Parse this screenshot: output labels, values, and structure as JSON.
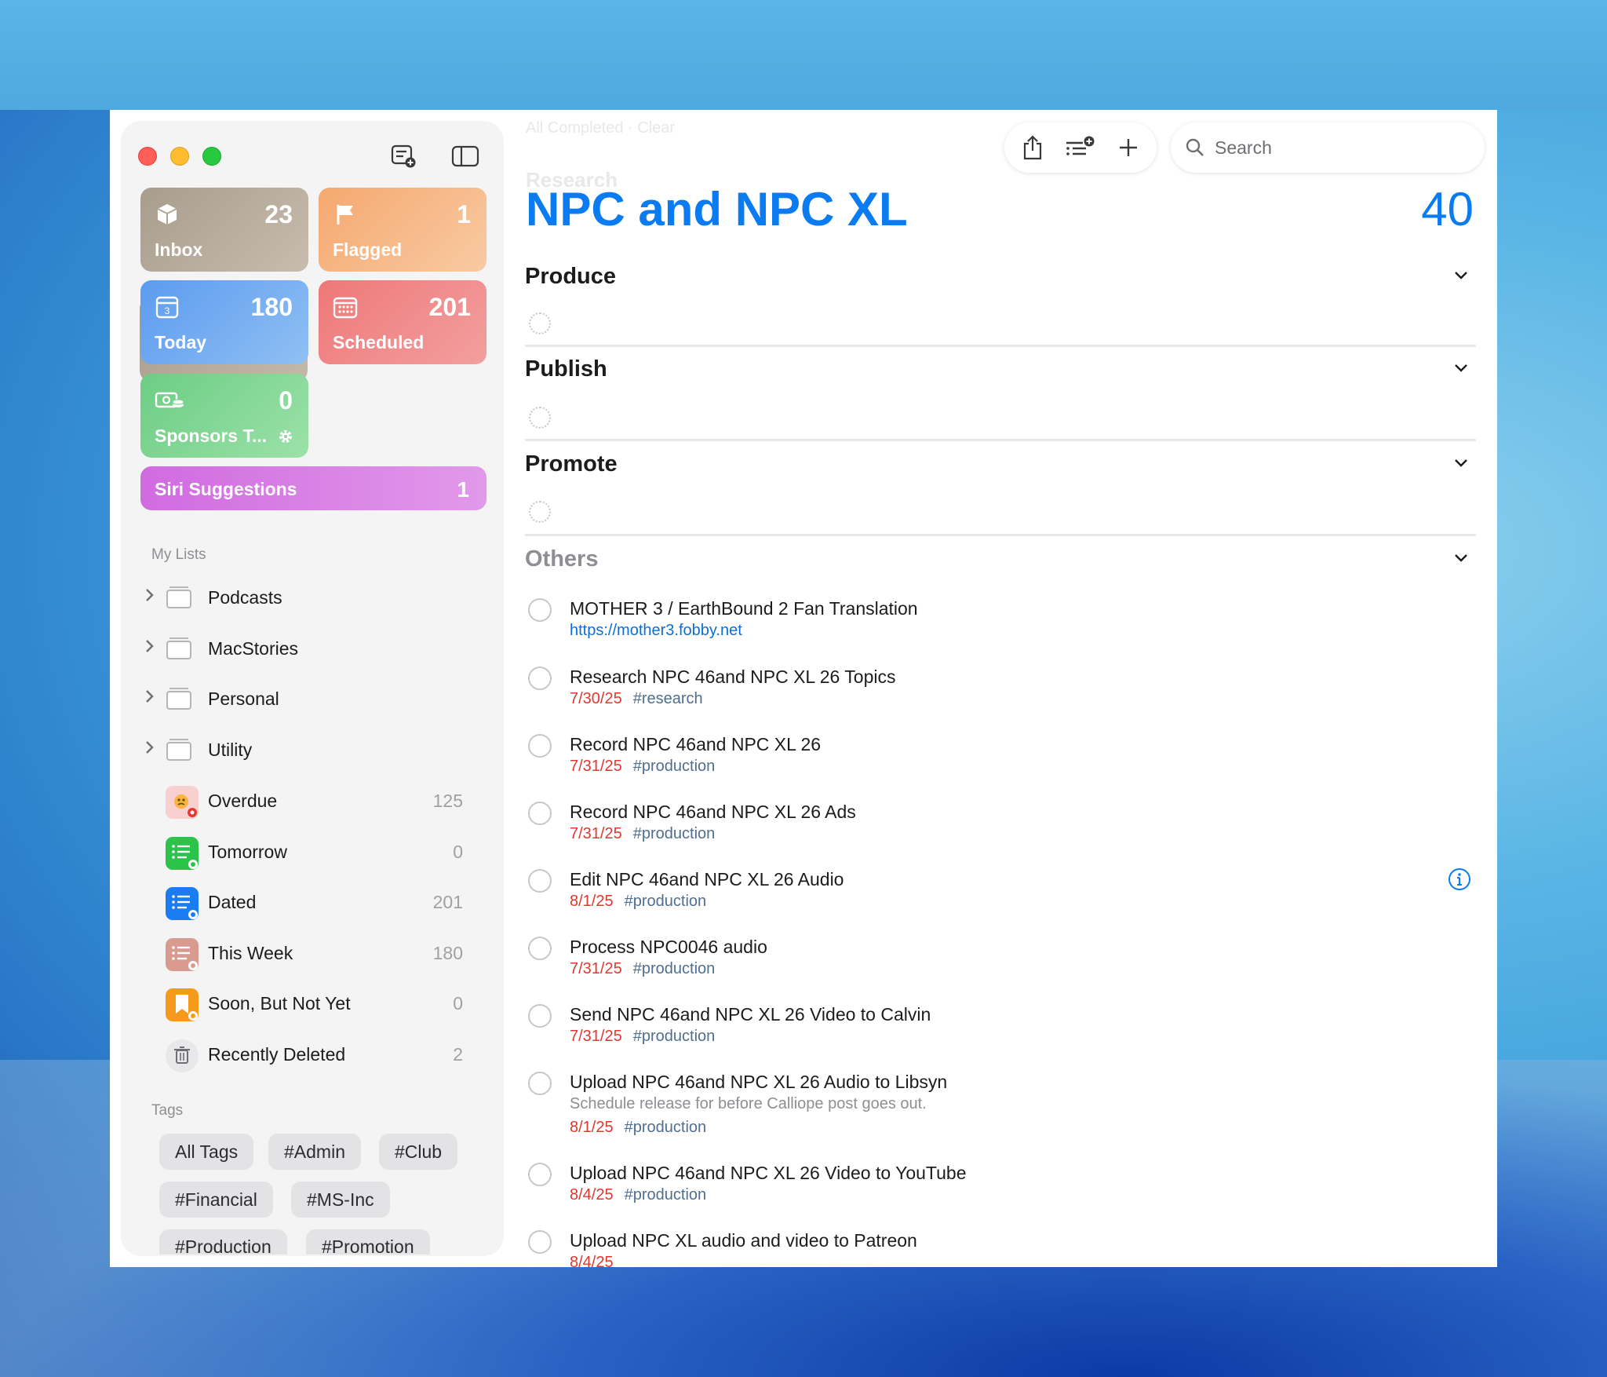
{
  "window": {
    "ghost_header": "All Completed · Clear",
    "ghost_section": "Research"
  },
  "toolbar": {
    "search_placeholder": "Search"
  },
  "sidebar": {
    "tiles": {
      "inbox": {
        "label": "Inbox",
        "count": "23"
      },
      "flagged": {
        "label": "Flagged",
        "count": "1"
      },
      "today": {
        "label": "Today",
        "count": "180",
        "icon_day": "3"
      },
      "scheduled": {
        "label": "Scheduled",
        "count": "201"
      },
      "sponsors": {
        "label": "Sponsors T...",
        "count": "0"
      }
    },
    "siri": {
      "label": "Siri Suggestions",
      "count": "1"
    },
    "my_lists_title": "My Lists",
    "groups": [
      {
        "label": "Podcasts"
      },
      {
        "label": "MacStories"
      },
      {
        "label": "Personal"
      },
      {
        "label": "Utility"
      }
    ],
    "lists": [
      {
        "label": "Overdue",
        "count": "125",
        "color": "#f7c6c6"
      },
      {
        "label": "Tomorrow",
        "count": "0",
        "color": "#2bc34a"
      },
      {
        "label": "Dated",
        "count": "201",
        "color": "#1a7cf2"
      },
      {
        "label": "This Week",
        "count": "180",
        "color": "#d99a90"
      },
      {
        "label": "Soon, But Not Yet",
        "count": "0",
        "color": "#f59a1a"
      },
      {
        "label": "Recently Deleted",
        "count": "2",
        "color": "#e5e5e8"
      }
    ],
    "tags_title": "Tags",
    "tags": [
      "All Tags",
      "#Admin",
      "#Club",
      "#Financial",
      "#MS-Inc",
      "#Production",
      "#Promotion"
    ]
  },
  "main": {
    "title": "NPC and NPC XL",
    "total": "40",
    "groups": [
      "Produce",
      "Publish",
      "Promote",
      "Others"
    ],
    "tasks": [
      {
        "title": "MOTHER 3 / EarthBound 2 Fan Translation",
        "link": "https://mother3.fobby.net"
      },
      {
        "title": "Research NPC 46and NPC XL 26 Topics",
        "date": "7/30/25",
        "tag": "#research"
      },
      {
        "title": "Record NPC 46and NPC XL 26",
        "date": "7/31/25",
        "tag": "#production"
      },
      {
        "title": "Record NPC 46and NPC XL 26 Ads",
        "date": "7/31/25",
        "tag": "#production"
      },
      {
        "title": "Edit NPC 46and NPC XL 26 Audio",
        "date": "8/1/25",
        "tag": "#production"
      },
      {
        "title": "Process NPC0046 audio",
        "date": "7/31/25",
        "tag": "#production"
      },
      {
        "title": "Send NPC 46and NPC XL 26 Video to Calvin",
        "date": "7/31/25",
        "tag": "#production"
      },
      {
        "title": "Upload NPC 46and NPC XL 26 Audio to Libsyn",
        "note": "Schedule release for before Calliope post goes out.",
        "date": "8/1/25",
        "tag": "#production"
      },
      {
        "title": "Upload NPC 46and NPC XL 26 Video to YouTube",
        "date": "8/4/25",
        "tag": "#production"
      },
      {
        "title": "Upload NPC XL audio and video to Patreon",
        "date": "8/4/25"
      }
    ]
  },
  "colors": {
    "accent": "#0a7bf0",
    "date_red": "#e0382f",
    "tag_blue": "#4f6f8f"
  }
}
